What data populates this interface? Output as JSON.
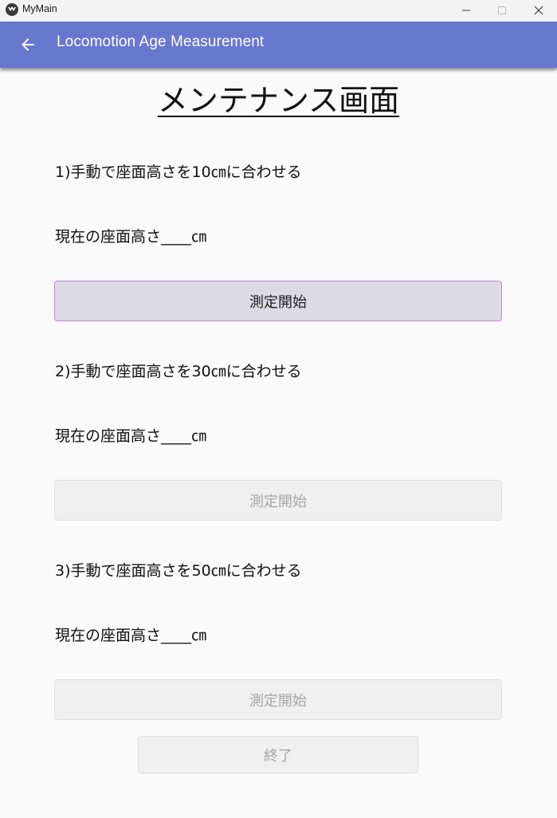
{
  "window": {
    "title": "MyMain",
    "icon": "app-bird-icon"
  },
  "appbar": {
    "title": "Locomotion Age Measurement",
    "back_icon": "arrow-left-icon",
    "color": "#6877ce"
  },
  "page": {
    "title": "メンテナンス画面"
  },
  "steps": [
    {
      "instruction": "1)手動で座面高さを10㎝に合わせる",
      "current_height": "現在の座面高さ____㎝",
      "button_label": "測定開始",
      "enabled": true
    },
    {
      "instruction": "2)手動で座面高さを30㎝に合わせる",
      "current_height": "現在の座面高さ____㎝",
      "button_label": "測定開始",
      "enabled": false
    },
    {
      "instruction": "3)手動で座面高さを50㎝に合わせる",
      "current_height": "現在の座面高さ____㎝",
      "button_label": "測定開始",
      "enabled": false
    }
  ],
  "exit_button": {
    "label": "終了",
    "enabled": false
  }
}
